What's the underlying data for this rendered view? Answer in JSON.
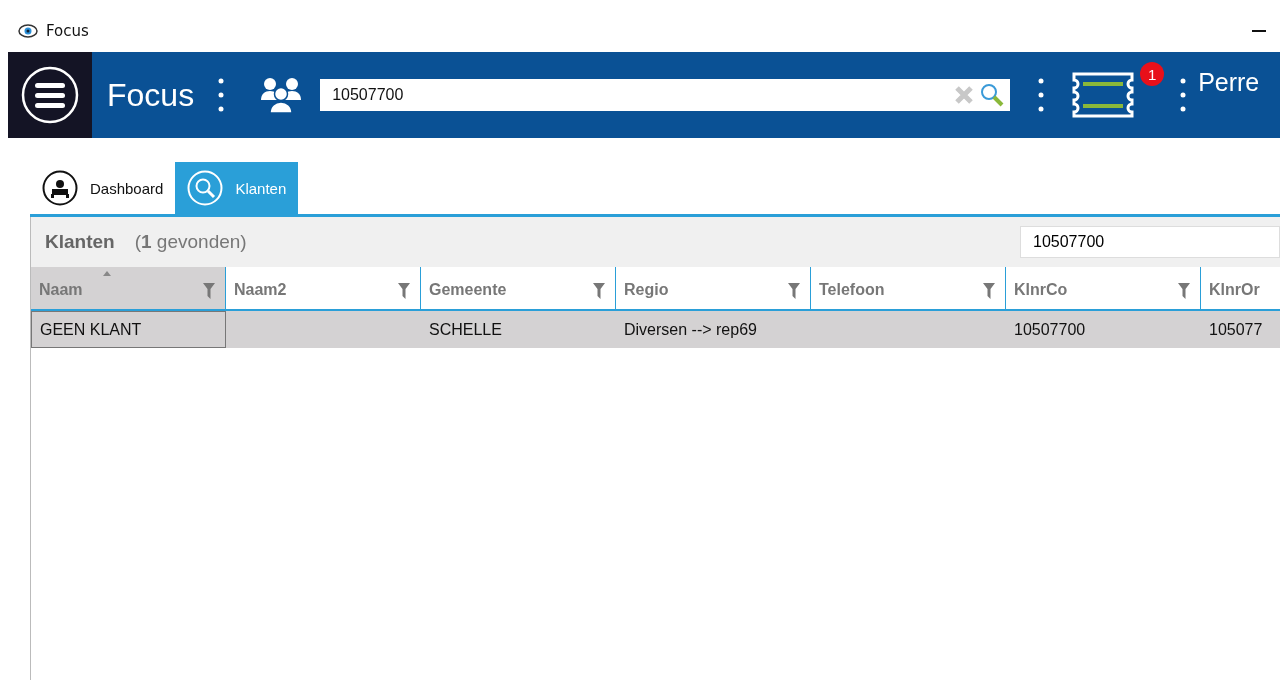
{
  "window": {
    "title": "Focus"
  },
  "header": {
    "app_title": "Focus",
    "search": {
      "value": "10507700"
    },
    "notification_count": "1",
    "user": "Perre"
  },
  "tabs": [
    {
      "label": "Dashboard",
      "selected": false,
      "kind": "dashboard"
    },
    {
      "label": "Klanten",
      "selected": true,
      "kind": "search"
    }
  ],
  "panel": {
    "title": "Klanten",
    "count": "(**1** gevonden)",
    "filter": {
      "value": "10507700"
    }
  },
  "table": {
    "columns": [
      {
        "name": "Naam",
        "sorted": true
      },
      {
        "name": "Naam2",
        "sorted": false
      },
      {
        "name": "Gemeente",
        "sorted": false
      },
      {
        "name": "Regio",
        "sorted": false
      },
      {
        "name": "Telefoon",
        "sorted": false
      },
      {
        "name": "KlnrCo",
        "sorted": false
      },
      {
        "name": "KlnrOr",
        "sorted": false
      }
    ],
    "rows": [
      {
        "selected": true,
        "cells": [
          "GEEN KLANT",
          "",
          "SCHELLE",
          "Diversen --> rep69",
          "",
          "10507700",
          "105077"
        ]
      }
    ]
  }
}
